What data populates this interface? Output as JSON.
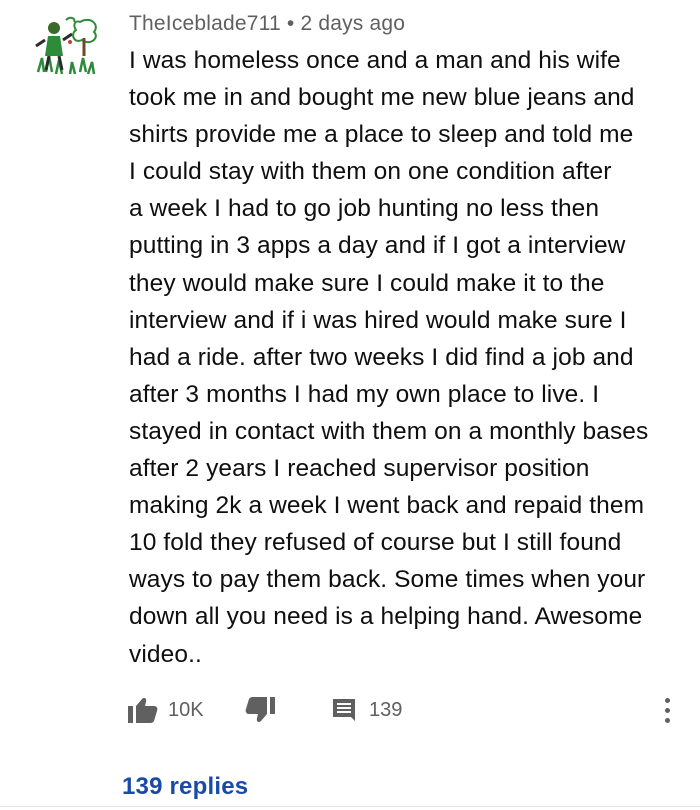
{
  "comment": {
    "username": "TheIceblade711",
    "separator": "•",
    "time_ago": "2 days ago",
    "body_lines": [
      "I was homeless once and a man and his  wife",
      "took me in and bought me new blue jeans and",
      "shirts provide me a place to sleep and told me",
      "I could stay with them on one condition after",
      "a week I had to go job hunting no less then",
      "putting in 3 apps a day and if I got a interview",
      "they would make sure I could make it to the",
      "interview and if i was hired would make sure I",
      "had a ride. after two weeks I did find a job and",
      "after 3 months I had my own place to live. I",
      "stayed in contact with them on a monthly bases",
      "after 2 years I reached supervisor position",
      "making 2k a week I went back and repaid them",
      "10 fold they refused of course but I still found",
      "ways to pay them back. Some times when your",
      "down all you need is a helping hand.  Awesome",
      "video.."
    ],
    "likes": "10K",
    "reply_count": "139",
    "replies_link": "139 replies"
  },
  "icons": {
    "avatar": "avatar-drawing",
    "like": "thumbs-up-icon",
    "dislike": "thumbs-down-icon",
    "reply": "comment-icon",
    "menu": "more-vertical-icon"
  },
  "colors": {
    "text": "#0f0f0f",
    "meta": "#606060",
    "link": "#1a4aa8",
    "avatar_green": "#2e8b3a"
  }
}
